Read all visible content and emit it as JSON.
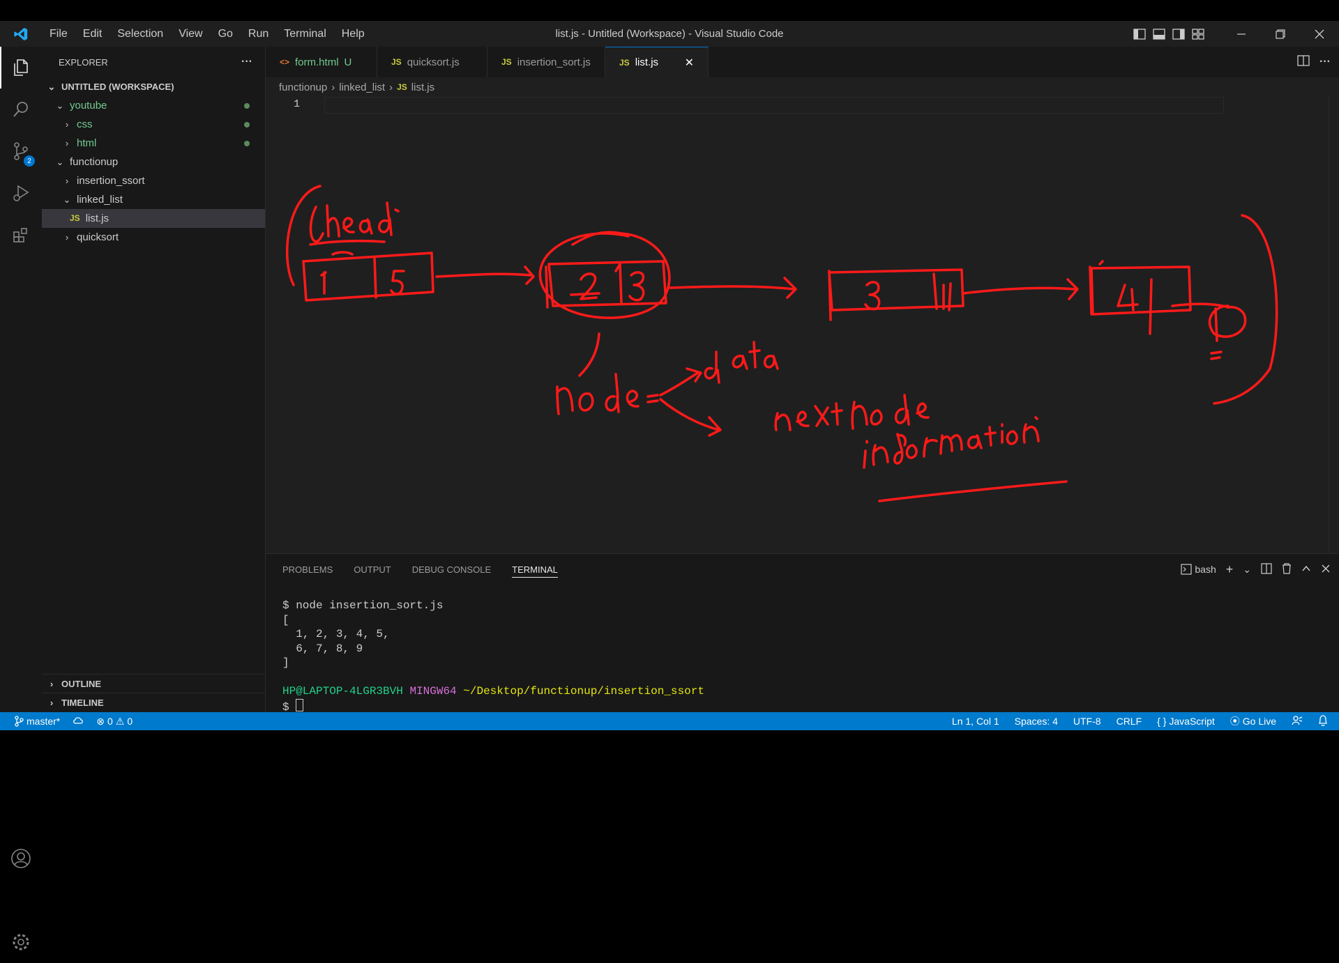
{
  "window": {
    "title": "list.js - Untitled (Workspace) - Visual Studio Code",
    "menu": [
      "File",
      "Edit",
      "Selection",
      "View",
      "Go",
      "Run",
      "Terminal",
      "Help"
    ]
  },
  "activity_bar": {
    "source_control_badge": "2"
  },
  "sidebar": {
    "header": "EXPLORER",
    "more": "···",
    "workspace": "UNTITLED (WORKSPACE)",
    "tree": [
      {
        "label": "youtube",
        "expanded": true
      },
      {
        "label": "css",
        "expanded": false
      },
      {
        "label": "html",
        "expanded": false
      },
      {
        "label": "functionup",
        "expanded": true
      },
      {
        "label": "insertion_ssort",
        "expanded": false
      },
      {
        "label": "linked_list",
        "expanded": true
      },
      {
        "label": "list.js",
        "file": true,
        "icon": "JS"
      },
      {
        "label": "quicksort",
        "expanded": false
      }
    ],
    "outline": "OUTLINE",
    "timeline": "TIMELINE"
  },
  "tabs": [
    {
      "label": "form.html",
      "icon": "<>",
      "modified": "U"
    },
    {
      "label": "quicksort.js",
      "icon": "JS"
    },
    {
      "label": "insertion_sort.js",
      "icon": "JS"
    },
    {
      "label": "list.js",
      "icon": "JS",
      "active": true,
      "close": "✕"
    }
  ],
  "breadcrumb": [
    "functionup",
    "linked_list",
    "list.js"
  ],
  "breadcrumb_icon": "JS",
  "editor": {
    "line_number": "1"
  },
  "panel": {
    "tabs": [
      "PROBLEMS",
      "OUTPUT",
      "DEBUG CONSOLE",
      "TERMINAL"
    ],
    "shell": "bash",
    "terminal": {
      "command": "$ node insertion_sort.js",
      "output": [
        "[",
        "  1, 2, 3, 4, 5,",
        "  6, 7, 8, 9",
        "]"
      ],
      "user": "HP@LAPTOP-4LGR3BVH",
      "host": "MINGW64",
      "path": "~/Desktop/functionup/insertion_ssort",
      "prompt": "$ "
    }
  },
  "statusbar": {
    "branch": "master*",
    "errors": "0",
    "warnings": "0",
    "position": "Ln 1, Col 1",
    "spaces": "Spaces: 4",
    "encoding": "UTF-8",
    "eol": "CRLF",
    "language": "JavaScript",
    "golive": "Go Live"
  },
  "colors": {
    "accent": "#007acc",
    "ink": "#ff1a1a",
    "editor_bg": "#1f1f1f",
    "sidebar_bg": "#181818"
  },
  "icons": [
    "vscode-logo-icon",
    "explorer-icon",
    "search-icon",
    "source-control-icon",
    "run-debug-icon",
    "extensions-icon",
    "account-icon",
    "gear-icon"
  ]
}
